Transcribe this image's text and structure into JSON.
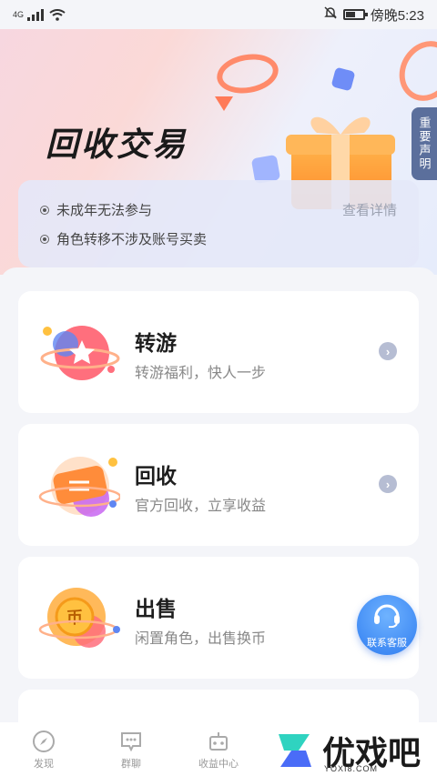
{
  "status_bar": {
    "network": "4G",
    "time": "傍晚5:23"
  },
  "hero": {
    "title": "回收交易",
    "notice_tab": "重要声明"
  },
  "notice": {
    "rules": [
      "未成年无法参与",
      "角色转移不涉及账号买卖"
    ],
    "detail_link": "查看详情"
  },
  "cards": [
    {
      "title": "转游",
      "subtitle": "转游福利，快人一步"
    },
    {
      "title": "回收",
      "subtitle": "官方回收，立享收益"
    },
    {
      "title": "出售",
      "subtitle": "闲置角色，出售换币"
    }
  ],
  "service_button": {
    "label": "联系客服"
  },
  "bottom_nav": [
    {
      "label": "发现",
      "icon": "compass-icon"
    },
    {
      "label": "群聊",
      "icon": "chat-icon"
    },
    {
      "label": "收益中心",
      "icon": "robot-icon"
    }
  ],
  "watermark": {
    "text": "优戏吧",
    "url": "YOXI8.COM"
  },
  "colors": {
    "accent": "#2f7cf0",
    "hero_ring": "#ff8a6a",
    "notice_tab": "#5b6f9c"
  }
}
